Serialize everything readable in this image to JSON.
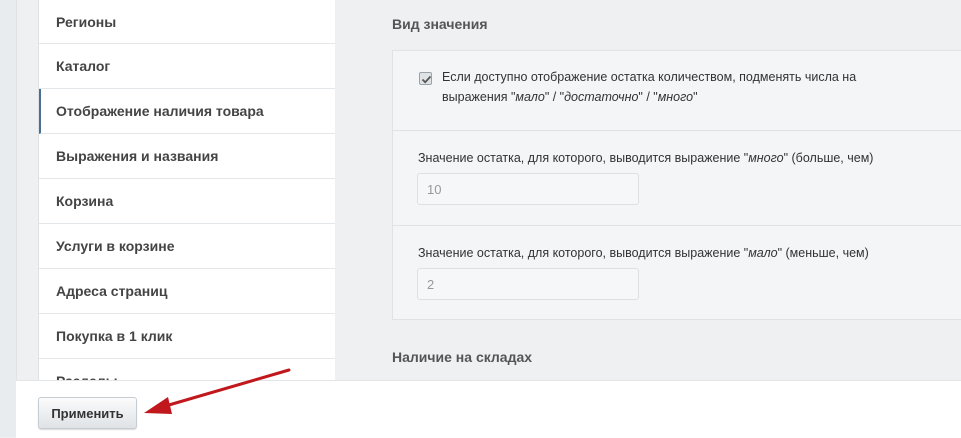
{
  "sidebar": {
    "items": [
      {
        "label": "Регионы"
      },
      {
        "label": "Каталог"
      },
      {
        "label": "Отображение наличия товара"
      },
      {
        "label": "Выражения и названия"
      },
      {
        "label": "Корзина"
      },
      {
        "label": "Услуги в корзине"
      },
      {
        "label": "Адреса страниц"
      },
      {
        "label": "Покупка в 1 клик"
      },
      {
        "label": "Разделы"
      }
    ],
    "active_index": 2
  },
  "main": {
    "section_value_type": "Вид значения",
    "checkbox": {
      "checked": true,
      "text_line1": "Если доступно отображение остатка количеством, подменять числа на",
      "text_line2_pre": "выражения \"",
      "text_line2_em1": "мало",
      "text_line2_mid1": "\" / \"",
      "text_line2_em2": "достаточно",
      "text_line2_mid2": "\" / \"",
      "text_line2_em3": "много",
      "text_line2_post": "\""
    },
    "field_many": {
      "label_pre": "Значение остатка, для которого, выводится выражение \"",
      "label_em": "много",
      "label_post": "\" (больше, чем)",
      "value": "10"
    },
    "field_few": {
      "label_pre": "Значение остатка, для которого, выводится выражение \"",
      "label_em": "мало",
      "label_post": "\" (меньше, чем)",
      "value": "2"
    },
    "section_warehouses": "Наличие на складах"
  },
  "footer": {
    "apply_label": "Применить"
  },
  "colors": {
    "arrow": "#c0181c"
  }
}
